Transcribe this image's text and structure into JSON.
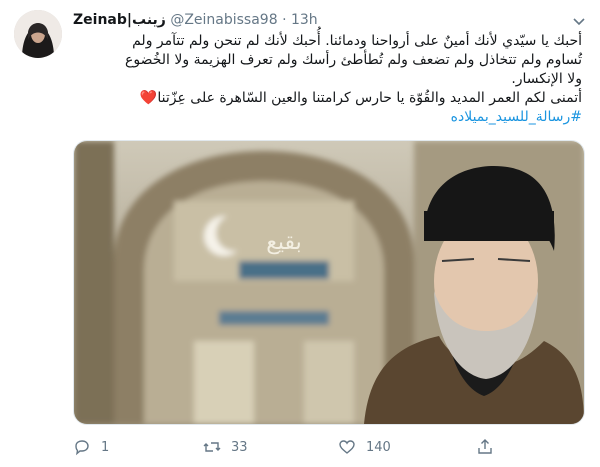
{
  "tweet": {
    "display_name": "Zeinab|زينب",
    "handle": "@Zeinabissa98",
    "separator": "·",
    "time": "13h",
    "body_lines": [
      "أحبك يا سيّدي لأنك أمينٌ على أرواحنا ودمائنا. أُحبك لأنك لم تنحن ولم تتآمر ولم",
      "تُساوم ولم تتخاذل ولم تضعف ولم تُطأطئ رأسك ولم تعرف الهزيمة ولا الخُضوع",
      "ولا الإنكسار.",
      "أتمنى لكم العمر المديد والقُوّة يا حارس كرامتنا والعين السّاهرة على عِزّتنا"
    ],
    "heart_emoji": "❤️",
    "hashtag": "#رسالة_للسيد_بميلاده",
    "media_sign_text": "بقيع"
  },
  "actions": {
    "reply_count": "1",
    "retweet_count": "33",
    "like_count": "140"
  },
  "colors": {
    "link": "#1b95e0",
    "muted": "#657786",
    "heart": "#e0245e"
  }
}
